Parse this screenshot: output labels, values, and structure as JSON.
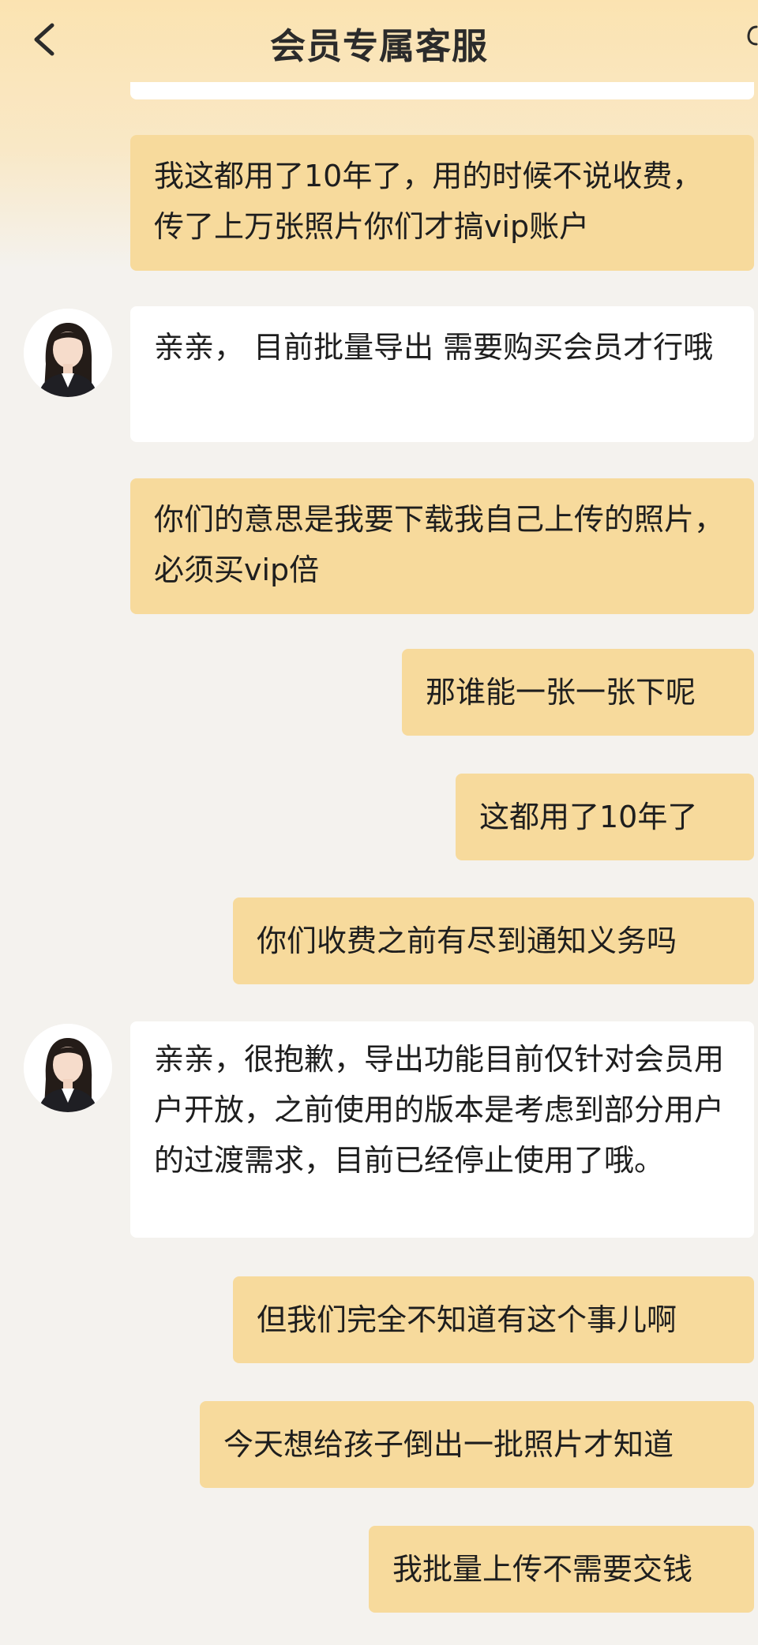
{
  "header": {
    "title": "会员专属客服"
  },
  "colors": {
    "user_bubble": "#f7da9c",
    "agent_bubble": "#ffffff",
    "background": "#f4f2ee",
    "header_gradient_top": "#fbe3b1"
  },
  "icons": {
    "back": "chevron-left-icon",
    "avatar": "agent-avatar"
  },
  "messages": [
    {
      "sender": "user",
      "text": "我这都用了10年了，用的时候不说收费，传了上万张照片你们才搞vip账户"
    },
    {
      "sender": "agent",
      "text": "亲亲， 目前批量导出 需要购买会员才行哦"
    },
    {
      "sender": "user",
      "text": "你们的意思是我要下载我自己上传的照片，必须买vip倍"
    },
    {
      "sender": "user",
      "text": "那谁能一张一张下呢"
    },
    {
      "sender": "user",
      "text": "这都用了10年了"
    },
    {
      "sender": "user",
      "text": "你们收费之前有尽到通知义务吗"
    },
    {
      "sender": "agent",
      "text": "亲亲，很抱歉，导出功能目前仅针对会员用户开放，之前使用的版本是考虑到部分用户的过渡需求，目前已经停止使用了哦。"
    },
    {
      "sender": "user",
      "text": "但我们完全不知道有这个事儿啊"
    },
    {
      "sender": "user",
      "text": "今天想给孩子倒出一批照片才知道"
    },
    {
      "sender": "user",
      "text": "我批量上传不需要交钱"
    }
  ]
}
